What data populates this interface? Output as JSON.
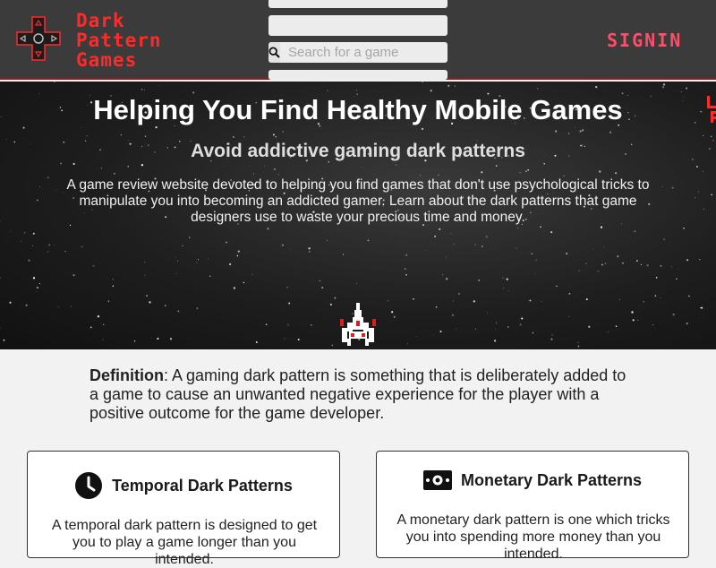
{
  "brand": {
    "lines": [
      "Dark",
      "Pattern",
      "Games"
    ],
    "logo_icon": "dpad-icon",
    "color": "#ff2a2a"
  },
  "search": {
    "placeholder": "Search for a game",
    "icon": "search-icon"
  },
  "header": {
    "signin_label": "SIGNIN",
    "signin_color": "#ff4d6a"
  },
  "hero": {
    "title": "Helping You Find Healthy Mobile Games",
    "subtitle": "Avoid addictive gaming dark patterns",
    "description": "A game review website devoted to helping you find games that don't use psychological tricks to manipulate you into becoming an addicted gamer. Learn about the dark patterns that game designers use to waste your precious time and money.",
    "ship_icon": "spaceship-icon"
  },
  "definition": {
    "term": "Definition",
    "text": ": A gaming dark pattern is something that is deliberately added to a game to cause an unwanted negative experience for the player with a positive outcome for the game developer."
  },
  "cards": [
    {
      "title": "Temporal Dark Patterns",
      "icon": "clock-icon",
      "text": "A temporal dark pattern is designed to get you to play a game longer than you intended."
    },
    {
      "title": "Monetary Dark Patterns",
      "icon": "money-icon",
      "text": "A monetary dark pattern is one which tricks you into spending more money than you intended."
    }
  ]
}
